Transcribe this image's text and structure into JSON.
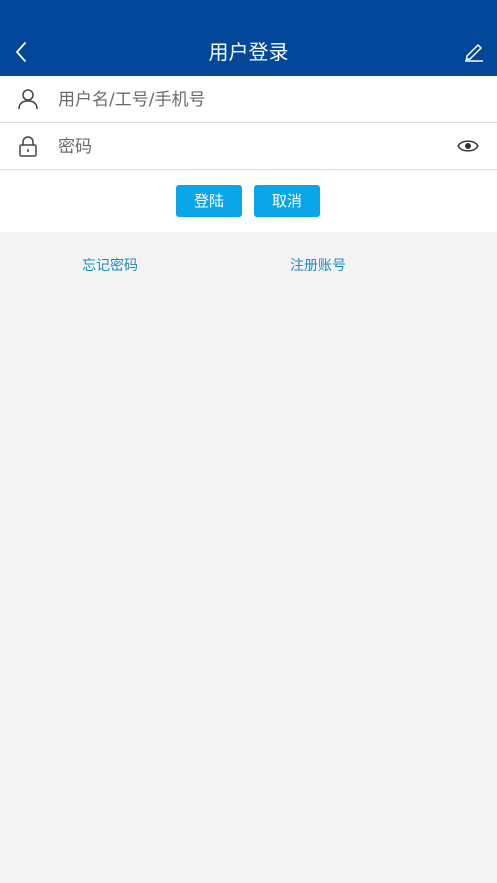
{
  "header": {
    "title": "用户登录",
    "back_icon": "chevron-left-icon",
    "edit_icon": "pencil-icon",
    "background_color": "#02479a"
  },
  "form": {
    "username": {
      "placeholder": "用户名/工号/手机号",
      "icon": "user-icon"
    },
    "password": {
      "placeholder": "密码",
      "icon": "lock-icon",
      "toggle_icon": "eye-icon"
    }
  },
  "actions": {
    "login_label": "登陆",
    "cancel_label": "取消",
    "button_color": "#0aa6e8"
  },
  "links": {
    "forgot_password": "忘记密码",
    "register": "注册账号",
    "link_color": "#1a8cc4"
  }
}
